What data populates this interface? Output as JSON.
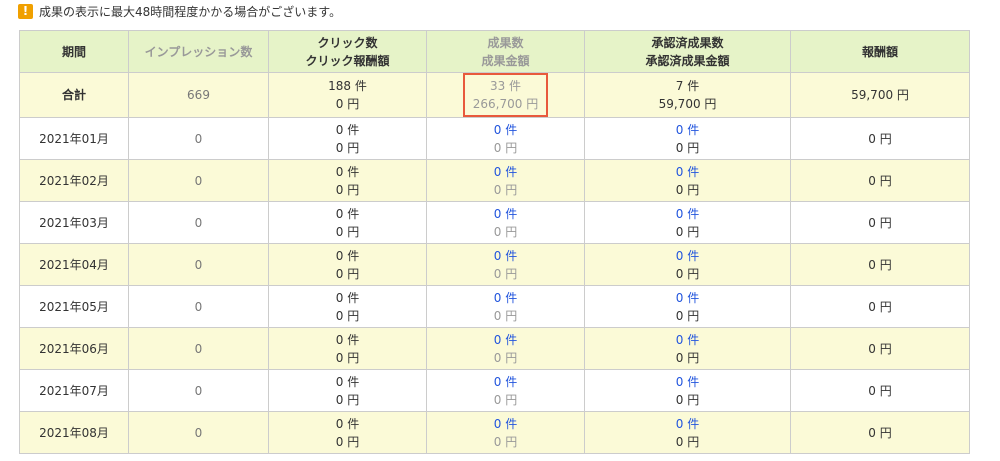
{
  "notice": {
    "text": "成果の表示に最大48時間程度かかる場合がございます。"
  },
  "header": {
    "period": "期間",
    "impressions": "インプレッション数",
    "click_count": "クリック数",
    "click_reward": "クリック報酬額",
    "conversion_count": "成果数",
    "conversion_amount": "成果金額",
    "approved_count": "承認済成果数",
    "approved_amount": "承認済成果金額",
    "reward": "報酬額"
  },
  "total": {
    "period": "合計",
    "impressions": "669",
    "click_count": "188 件",
    "click_reward": "0 円",
    "conversion_count": "33 件",
    "conversion_amount": "266,700 円",
    "approved_count": "7 件",
    "approved_amount": "59,700 円",
    "reward": "59,700 円"
  },
  "rows": [
    {
      "period": "2021年01月",
      "impressions": "0",
      "click_count": "0 件",
      "click_reward": "0 円",
      "conversion_count": "0 件",
      "conversion_amount": "0 円",
      "approved_count": "0 件",
      "approved_amount": "0 円",
      "reward": "0 円"
    },
    {
      "period": "2021年02月",
      "impressions": "0",
      "click_count": "0 件",
      "click_reward": "0 円",
      "conversion_count": "0 件",
      "conversion_amount": "0 円",
      "approved_count": "0 件",
      "approved_amount": "0 円",
      "reward": "0 円"
    },
    {
      "period": "2021年03月",
      "impressions": "0",
      "click_count": "0 件",
      "click_reward": "0 円",
      "conversion_count": "0 件",
      "conversion_amount": "0 円",
      "approved_count": "0 件",
      "approved_amount": "0 円",
      "reward": "0 円"
    },
    {
      "period": "2021年04月",
      "impressions": "0",
      "click_count": "0 件",
      "click_reward": "0 円",
      "conversion_count": "0 件",
      "conversion_amount": "0 円",
      "approved_count": "0 件",
      "approved_amount": "0 円",
      "reward": "0 円"
    },
    {
      "period": "2021年05月",
      "impressions": "0",
      "click_count": "0 件",
      "click_reward": "0 円",
      "conversion_count": "0 件",
      "conversion_amount": "0 円",
      "approved_count": "0 件",
      "approved_amount": "0 円",
      "reward": "0 円"
    },
    {
      "period": "2021年06月",
      "impressions": "0",
      "click_count": "0 件",
      "click_reward": "0 円",
      "conversion_count": "0 件",
      "conversion_amount": "0 円",
      "approved_count": "0 件",
      "approved_amount": "0 円",
      "reward": "0 円"
    },
    {
      "period": "2021年07月",
      "impressions": "0",
      "click_count": "0 件",
      "click_reward": "0 円",
      "conversion_count": "0 件",
      "conversion_amount": "0 円",
      "approved_count": "0 件",
      "approved_amount": "0 円",
      "reward": "0 円"
    },
    {
      "period": "2021年08月",
      "impressions": "0",
      "click_count": "0 件",
      "click_reward": "0 円",
      "conversion_count": "0 件",
      "conversion_amount": "0 円",
      "approved_count": "0 件",
      "approved_amount": "0 円",
      "reward": "0 円"
    }
  ],
  "icons": {
    "warning": "exclamation-warning-icon"
  },
  "colors": {
    "header_bg": "#e6f3c8",
    "stripe_bg": "#fbfad7",
    "link_blue": "#2255dd",
    "highlight_red": "#e8593c",
    "warning_orange": "#f0a000"
  }
}
